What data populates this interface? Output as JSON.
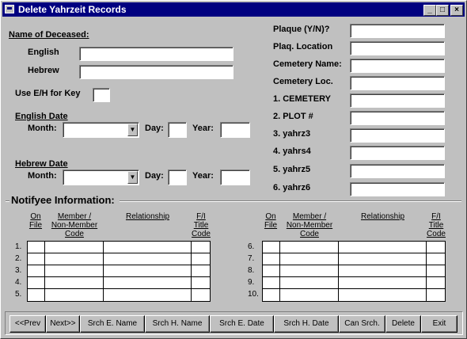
{
  "window": {
    "title": "Delete Yahrzeit Records",
    "min_icon": "minimize-icon",
    "max_icon": "maximize-icon",
    "close_icon": "close-icon"
  },
  "deceased": {
    "section_label": "Name of Deceased:",
    "english_label": "English",
    "english_value": "",
    "hebrew_label": "Hebrew",
    "hebrew_value": "",
    "key_label": "Use E/H for Key",
    "key_value": ""
  },
  "english_date": {
    "section_label": "English Date",
    "month_label": "Month:",
    "month_value": "",
    "day_label": "Day:",
    "day_value": "",
    "year_label": "Year:",
    "year_value": ""
  },
  "hebrew_date": {
    "section_label": "Hebrew Date",
    "month_label": "Month:",
    "month_value": "",
    "day_label": "Day:",
    "day_value": "",
    "year_label": "Year:",
    "year_value": ""
  },
  "right_fields": [
    {
      "label": "Plaque (Y/N)?",
      "value": ""
    },
    {
      "label": "Plaq. Location",
      "value": ""
    },
    {
      "label": "Cemetery Name:",
      "value": ""
    },
    {
      "label": "Cemetery Loc.",
      "value": ""
    },
    {
      "label": "1. CEMETERY",
      "value": ""
    },
    {
      "label": "2. PLOT #",
      "value": ""
    },
    {
      "label": "3. yahrz3",
      "value": ""
    },
    {
      "label": "4. yahrs4",
      "value": ""
    },
    {
      "label": "5. yahrz5",
      "value": ""
    },
    {
      "label": "6. yahrz6",
      "value": ""
    }
  ],
  "notifyee": {
    "section_label": "Notifyee Information:",
    "headers": {
      "on_file": [
        "On",
        "File"
      ],
      "member": [
        "Member /",
        "Non-Member",
        "Code"
      ],
      "relationship": "Relationship",
      "fi": [
        "F/I",
        "Title",
        "Code"
      ]
    },
    "left_rows": [
      "1.",
      "2.",
      "3.",
      "4.",
      "5."
    ],
    "right_rows": [
      "6.",
      "7.",
      "8.",
      "9.",
      "10."
    ]
  },
  "buttons": [
    "<<Prev",
    "Next>>",
    "Srch E. Name",
    "Srch H. Name",
    "Srch E. Date",
    "Srch H. Date",
    "Can Srch.",
    "Delete",
    "Exit"
  ]
}
